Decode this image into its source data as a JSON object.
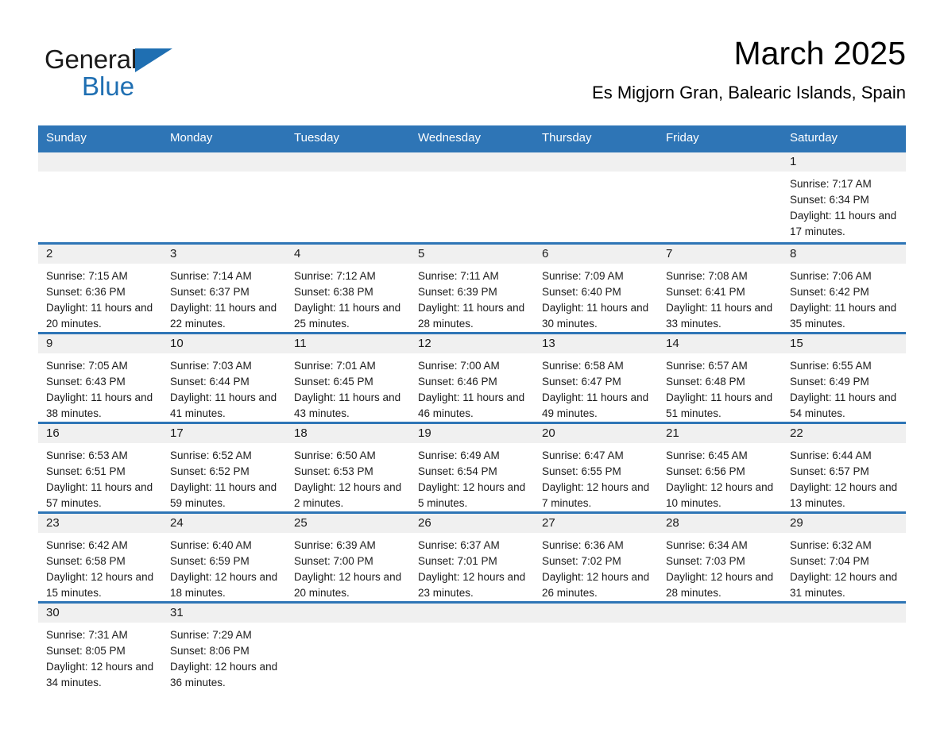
{
  "brand": {
    "word1": "General",
    "word2": "Blue",
    "triangle_color": "#1f6fb2",
    "text_color": "#1b1b1b"
  },
  "header": {
    "month_title": "March 2025",
    "location": "Es Migjorn Gran, Balearic Islands, Spain",
    "accent_color": "#2e75b6",
    "daynum_bg": "#f0f0f0"
  },
  "weekday_headers": [
    "Sunday",
    "Monday",
    "Tuesday",
    "Wednesday",
    "Thursday",
    "Friday",
    "Saturday"
  ],
  "labels": {
    "sunrise_prefix": "Sunrise:",
    "sunset_prefix": "Sunset:",
    "daylight_prefix": "Daylight:"
  },
  "weeks": [
    [
      {
        "day": "",
        "empty": true
      },
      {
        "day": "",
        "empty": true
      },
      {
        "day": "",
        "empty": true
      },
      {
        "day": "",
        "empty": true
      },
      {
        "day": "",
        "empty": true
      },
      {
        "day": "",
        "empty": true
      },
      {
        "day": "1",
        "sunrise": "Sunrise: 7:17 AM",
        "sunset": "Sunset: 6:34 PM",
        "daylight": "Daylight: 11 hours and 17 minutes."
      }
    ],
    [
      {
        "day": "2",
        "sunrise": "Sunrise: 7:15 AM",
        "sunset": "Sunset: 6:36 PM",
        "daylight": "Daylight: 11 hours and 20 minutes."
      },
      {
        "day": "3",
        "sunrise": "Sunrise: 7:14 AM",
        "sunset": "Sunset: 6:37 PM",
        "daylight": "Daylight: 11 hours and 22 minutes."
      },
      {
        "day": "4",
        "sunrise": "Sunrise: 7:12 AM",
        "sunset": "Sunset: 6:38 PM",
        "daylight": "Daylight: 11 hours and 25 minutes."
      },
      {
        "day": "5",
        "sunrise": "Sunrise: 7:11 AM",
        "sunset": "Sunset: 6:39 PM",
        "daylight": "Daylight: 11 hours and 28 minutes."
      },
      {
        "day": "6",
        "sunrise": "Sunrise: 7:09 AM",
        "sunset": "Sunset: 6:40 PM",
        "daylight": "Daylight: 11 hours and 30 minutes."
      },
      {
        "day": "7",
        "sunrise": "Sunrise: 7:08 AM",
        "sunset": "Sunset: 6:41 PM",
        "daylight": "Daylight: 11 hours and 33 minutes."
      },
      {
        "day": "8",
        "sunrise": "Sunrise: 7:06 AM",
        "sunset": "Sunset: 6:42 PM",
        "daylight": "Daylight: 11 hours and 35 minutes."
      }
    ],
    [
      {
        "day": "9",
        "sunrise": "Sunrise: 7:05 AM",
        "sunset": "Sunset: 6:43 PM",
        "daylight": "Daylight: 11 hours and 38 minutes."
      },
      {
        "day": "10",
        "sunrise": "Sunrise: 7:03 AM",
        "sunset": "Sunset: 6:44 PM",
        "daylight": "Daylight: 11 hours and 41 minutes."
      },
      {
        "day": "11",
        "sunrise": "Sunrise: 7:01 AM",
        "sunset": "Sunset: 6:45 PM",
        "daylight": "Daylight: 11 hours and 43 minutes."
      },
      {
        "day": "12",
        "sunrise": "Sunrise: 7:00 AM",
        "sunset": "Sunset: 6:46 PM",
        "daylight": "Daylight: 11 hours and 46 minutes."
      },
      {
        "day": "13",
        "sunrise": "Sunrise: 6:58 AM",
        "sunset": "Sunset: 6:47 PM",
        "daylight": "Daylight: 11 hours and 49 minutes."
      },
      {
        "day": "14",
        "sunrise": "Sunrise: 6:57 AM",
        "sunset": "Sunset: 6:48 PM",
        "daylight": "Daylight: 11 hours and 51 minutes."
      },
      {
        "day": "15",
        "sunrise": "Sunrise: 6:55 AM",
        "sunset": "Sunset: 6:49 PM",
        "daylight": "Daylight: 11 hours and 54 minutes."
      }
    ],
    [
      {
        "day": "16",
        "sunrise": "Sunrise: 6:53 AM",
        "sunset": "Sunset: 6:51 PM",
        "daylight": "Daylight: 11 hours and 57 minutes."
      },
      {
        "day": "17",
        "sunrise": "Sunrise: 6:52 AM",
        "sunset": "Sunset: 6:52 PM",
        "daylight": "Daylight: 11 hours and 59 minutes."
      },
      {
        "day": "18",
        "sunrise": "Sunrise: 6:50 AM",
        "sunset": "Sunset: 6:53 PM",
        "daylight": "Daylight: 12 hours and 2 minutes."
      },
      {
        "day": "19",
        "sunrise": "Sunrise: 6:49 AM",
        "sunset": "Sunset: 6:54 PM",
        "daylight": "Daylight: 12 hours and 5 minutes."
      },
      {
        "day": "20",
        "sunrise": "Sunrise: 6:47 AM",
        "sunset": "Sunset: 6:55 PM",
        "daylight": "Daylight: 12 hours and 7 minutes."
      },
      {
        "day": "21",
        "sunrise": "Sunrise: 6:45 AM",
        "sunset": "Sunset: 6:56 PM",
        "daylight": "Daylight: 12 hours and 10 minutes."
      },
      {
        "day": "22",
        "sunrise": "Sunrise: 6:44 AM",
        "sunset": "Sunset: 6:57 PM",
        "daylight": "Daylight: 12 hours and 13 minutes."
      }
    ],
    [
      {
        "day": "23",
        "sunrise": "Sunrise: 6:42 AM",
        "sunset": "Sunset: 6:58 PM",
        "daylight": "Daylight: 12 hours and 15 minutes."
      },
      {
        "day": "24",
        "sunrise": "Sunrise: 6:40 AM",
        "sunset": "Sunset: 6:59 PM",
        "daylight": "Daylight: 12 hours and 18 minutes."
      },
      {
        "day": "25",
        "sunrise": "Sunrise: 6:39 AM",
        "sunset": "Sunset: 7:00 PM",
        "daylight": "Daylight: 12 hours and 20 minutes."
      },
      {
        "day": "26",
        "sunrise": "Sunrise: 6:37 AM",
        "sunset": "Sunset: 7:01 PM",
        "daylight": "Daylight: 12 hours and 23 minutes."
      },
      {
        "day": "27",
        "sunrise": "Sunrise: 6:36 AM",
        "sunset": "Sunset: 7:02 PM",
        "daylight": "Daylight: 12 hours and 26 minutes."
      },
      {
        "day": "28",
        "sunrise": "Sunrise: 6:34 AM",
        "sunset": "Sunset: 7:03 PM",
        "daylight": "Daylight: 12 hours and 28 minutes."
      },
      {
        "day": "29",
        "sunrise": "Sunrise: 6:32 AM",
        "sunset": "Sunset: 7:04 PM",
        "daylight": "Daylight: 12 hours and 31 minutes."
      }
    ],
    [
      {
        "day": "30",
        "sunrise": "Sunrise: 7:31 AM",
        "sunset": "Sunset: 8:05 PM",
        "daylight": "Daylight: 12 hours and 34 minutes."
      },
      {
        "day": "31",
        "sunrise": "Sunrise: 7:29 AM",
        "sunset": "Sunset: 8:06 PM",
        "daylight": "Daylight: 12 hours and 36 minutes."
      },
      {
        "day": "",
        "empty": true
      },
      {
        "day": "",
        "empty": true
      },
      {
        "day": "",
        "empty": true
      },
      {
        "day": "",
        "empty": true
      },
      {
        "day": "",
        "empty": true
      }
    ]
  ]
}
